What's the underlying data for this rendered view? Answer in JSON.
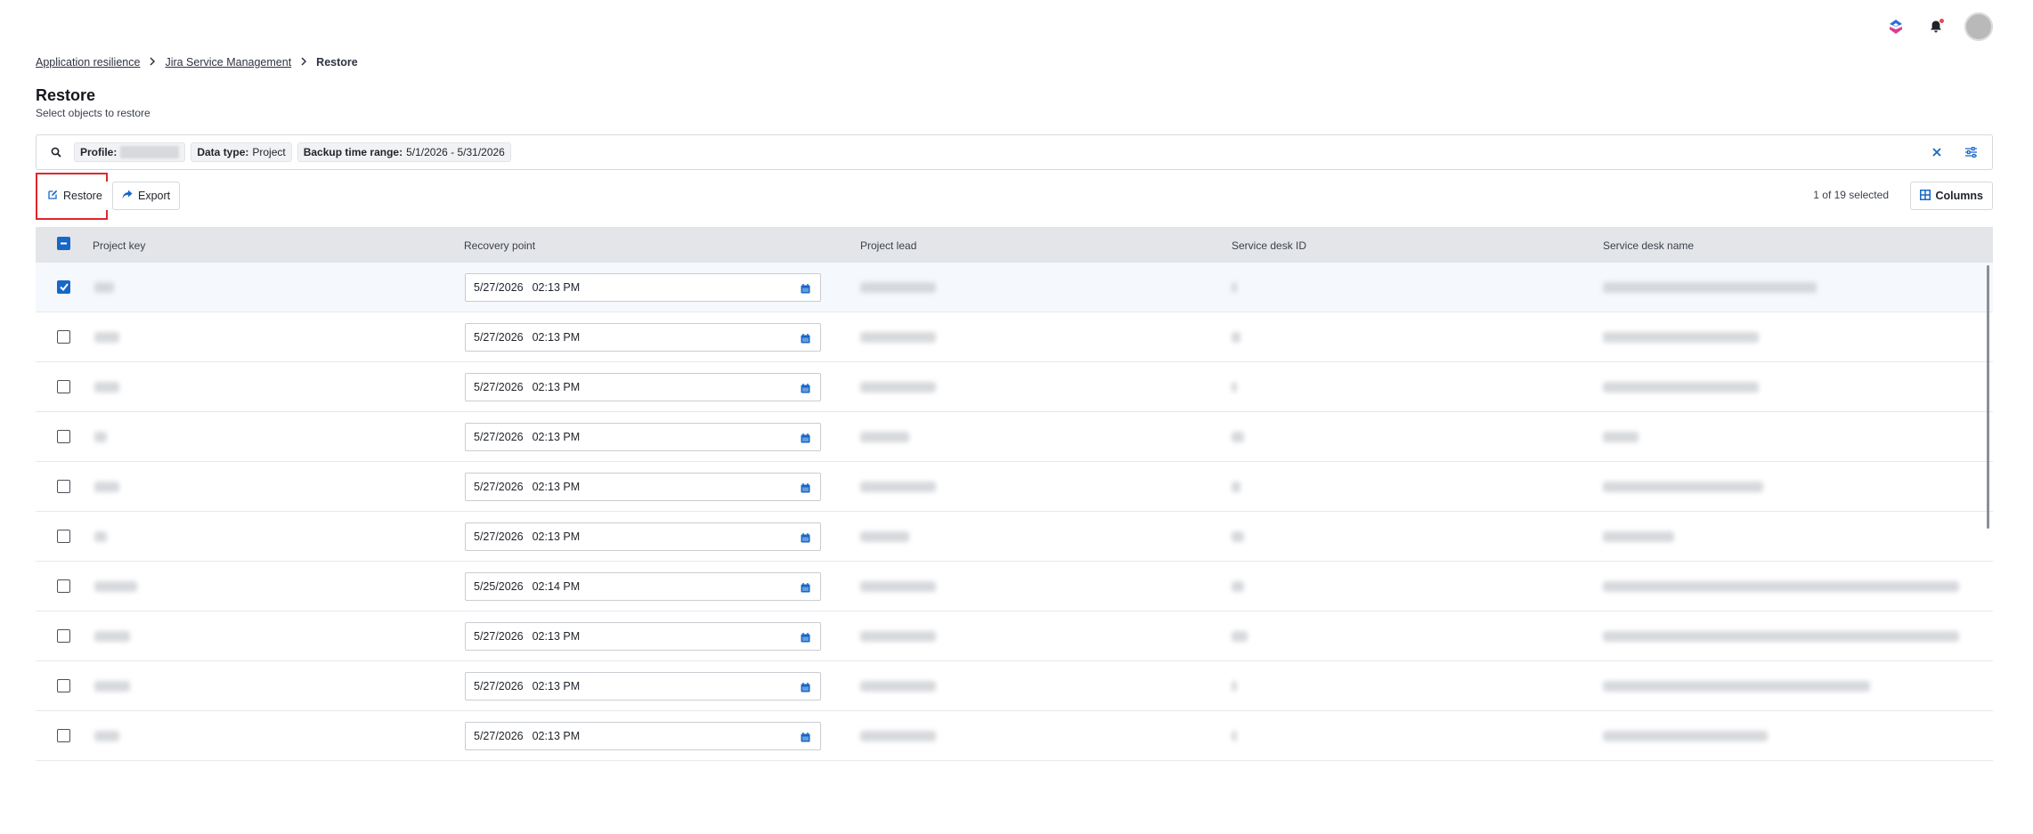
{
  "breadcrumb": [
    {
      "label": "Application resilience",
      "link": true
    },
    {
      "label": "Jira Service Management",
      "link": true
    },
    {
      "label": "Restore",
      "link": false
    }
  ],
  "page": {
    "title": "Restore",
    "subtitle": "Select objects to restore"
  },
  "filters": {
    "profile_label": "Profile:",
    "datatype_label": "Data type:",
    "datatype_value": "Project",
    "range_label": "Backup time range:",
    "range_value": "5/1/2026 - 5/31/2026"
  },
  "toolbar": {
    "restore_label": "Restore",
    "export_label": "Export",
    "selected_count": "1 of 19 selected",
    "columns_label": "Columns"
  },
  "table": {
    "headers": [
      "Project key",
      "Recovery point",
      "Project lead",
      "Service desk ID",
      "Service desk name"
    ],
    "rows": [
      {
        "checked": true,
        "date": "5/27/2026",
        "time": "02:13 PM"
      },
      {
        "checked": false,
        "date": "5/27/2026",
        "time": "02:13 PM"
      },
      {
        "checked": false,
        "date": "5/27/2026",
        "time": "02:13 PM"
      },
      {
        "checked": false,
        "date": "5/27/2026",
        "time": "02:13 PM"
      },
      {
        "checked": false,
        "date": "5/27/2026",
        "time": "02:13 PM"
      },
      {
        "checked": false,
        "date": "5/27/2026",
        "time": "02:13 PM"
      },
      {
        "checked": false,
        "date": "5/25/2026",
        "time": "02:14 PM"
      },
      {
        "checked": false,
        "date": "5/27/2026",
        "time": "02:13 PM"
      },
      {
        "checked": false,
        "date": "5/27/2026",
        "time": "02:13 PM"
      },
      {
        "checked": false,
        "date": "5/27/2026",
        "time": "02:13 PM"
      }
    ]
  },
  "colors": {
    "accent": "#1767c8",
    "highlight": "#e0262d",
    "header_bg": "#e4e5e8"
  },
  "icons": {
    "search": "search-icon",
    "clear": "close-icon",
    "filter_settings": "sliders-icon",
    "restore": "edit-icon",
    "export": "share-arrow-icon",
    "columns": "grid-icon",
    "calendar": "calendar-icon",
    "notifications": "bell-icon",
    "app": "app-logo-icon"
  }
}
